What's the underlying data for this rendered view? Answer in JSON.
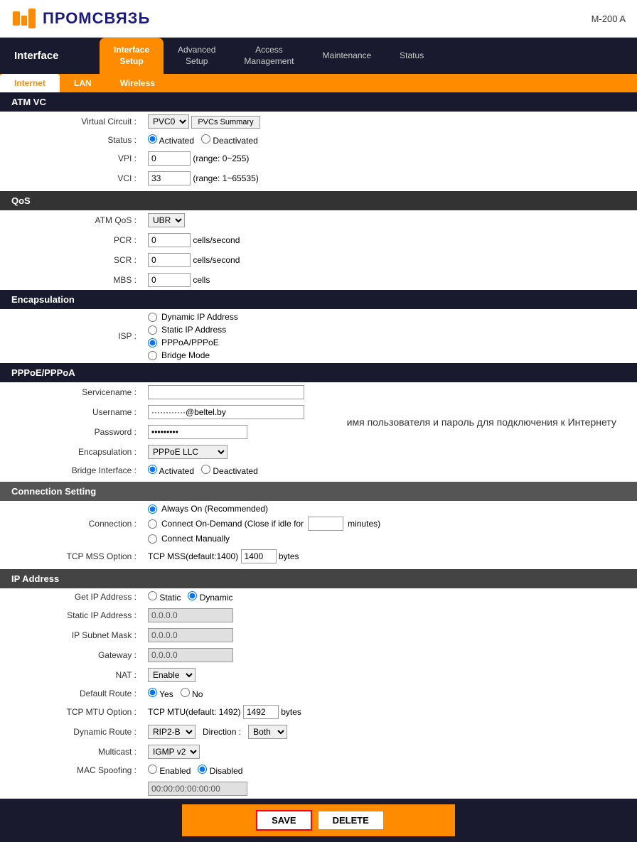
{
  "header": {
    "logo_text": "ПРОМСВЯЗЬ",
    "model": "M-200 A"
  },
  "nav": {
    "interface_label": "Interface",
    "tabs": [
      {
        "id": "interface-setup",
        "label": "Interface\nSetup",
        "active": true
      },
      {
        "id": "advanced-setup",
        "label": "Advanced\nSetup",
        "active": false
      },
      {
        "id": "access-management",
        "label": "Access\nManagement",
        "active": false
      },
      {
        "id": "maintenance",
        "label": "Maintenance",
        "active": false
      },
      {
        "id": "status",
        "label": "Status",
        "active": false
      }
    ],
    "sub_tabs": [
      {
        "id": "internet",
        "label": "Internet",
        "active": true
      },
      {
        "id": "lan",
        "label": "LAN",
        "active": false
      },
      {
        "id": "wireless",
        "label": "Wireless",
        "active": false
      }
    ]
  },
  "sections": {
    "atm_vc": {
      "title": "ATM VC",
      "virtual_circuit_label": "Virtual Circuit :",
      "virtual_circuit_value": "PVC0",
      "pvcs_summary_label": "PVCs Summary",
      "status_label": "Status :",
      "status_activated": "Activated",
      "status_deactivated": "Deactivated",
      "vpi_label": "VPI :",
      "vpi_value": "0",
      "vpi_range": "(range: 0~255)",
      "vci_label": "VCI :",
      "vci_value": "33",
      "vci_range": "(range: 1~65535)"
    },
    "qos": {
      "title": "QoS",
      "atm_qos_label": "ATM QoS :",
      "atm_qos_value": "UBR",
      "pcr_label": "PCR :",
      "pcr_value": "0",
      "pcr_unit": "cells/second",
      "scr_label": "SCR :",
      "scr_value": "0",
      "scr_unit": "cells/second",
      "mbs_label": "MBS :",
      "mbs_value": "0",
      "mbs_unit": "cells"
    },
    "encapsulation": {
      "title": "Encapsulation",
      "isp_label": "ISP :",
      "options": [
        "Dynamic IP Address",
        "Static IP Address",
        "PPPoA/PPPoE",
        "Bridge Mode"
      ],
      "selected": "PPPoA/PPPoE"
    },
    "pppoe_pppoa": {
      "title": "PPPoE/PPPoA",
      "servicename_label": "Servicename :",
      "servicename_value": "",
      "username_label": "Username :",
      "username_value": "••••••••••••@beltel.by",
      "password_label": "Password :",
      "password_value": "•••••••••",
      "encapsulation_label": "Encapsulation :",
      "encapsulation_value": "PPPoE LLC",
      "bridge_interface_label": "Bridge Interface :",
      "bridge_interface_activated": "Activated",
      "bridge_interface_deactivated": "Deactivated",
      "annotation": "имя пользователя и пароль для подключения к Интернету"
    },
    "connection_setting": {
      "title": "Connection Setting",
      "connection_label": "Connection :",
      "always_on": "Always On (Recommended)",
      "connect_on_demand": "Connect On-Demand (Close if idle for",
      "minutes_value": "",
      "minutes_unit": "minutes)",
      "connect_manually": "Connect Manually",
      "tcp_mss_label": "TCP MSS Option :",
      "tcp_mss_text": "TCP MSS(default:1400)",
      "tcp_mss_value": "1400",
      "tcp_mss_unit": "bytes"
    },
    "ip_address": {
      "title": "IP Address",
      "get_ip_label": "Get IP Address :",
      "get_ip_static": "Static",
      "get_ip_dynamic": "Dynamic",
      "static_ip_label": "Static IP Address :",
      "static_ip_value": "0.0.0.0",
      "subnet_mask_label": "IP Subnet Mask :",
      "subnet_mask_value": "0.0.0.0",
      "gateway_label": "Gateway :",
      "gateway_value": "0.0.0.0",
      "nat_label": "NAT :",
      "nat_value": "Enable",
      "default_route_label": "Default Route :",
      "default_route_yes": "Yes",
      "default_route_no": "No",
      "tcp_mtu_label": "TCP MTU Option :",
      "tcp_mtu_text": "TCP MTU(default: 1492)",
      "tcp_mtu_value": "1492",
      "tcp_mtu_unit": "bytes",
      "dynamic_route_label": "Dynamic Route :",
      "dynamic_route_value": "RIP2-B",
      "direction_label": "Direction :",
      "direction_value": "Both",
      "multicast_label": "Multicast :",
      "multicast_value": "IGMP v2",
      "mac_spoofing_label": "MAC Spoofing :",
      "mac_spoofing_enabled": "Enabled",
      "mac_spoofing_disabled": "Disabled",
      "mac_address_value": "00:00:00:00:00:00"
    }
  },
  "footer": {
    "save_label": "SAVE",
    "delete_label": "DELETE"
  }
}
